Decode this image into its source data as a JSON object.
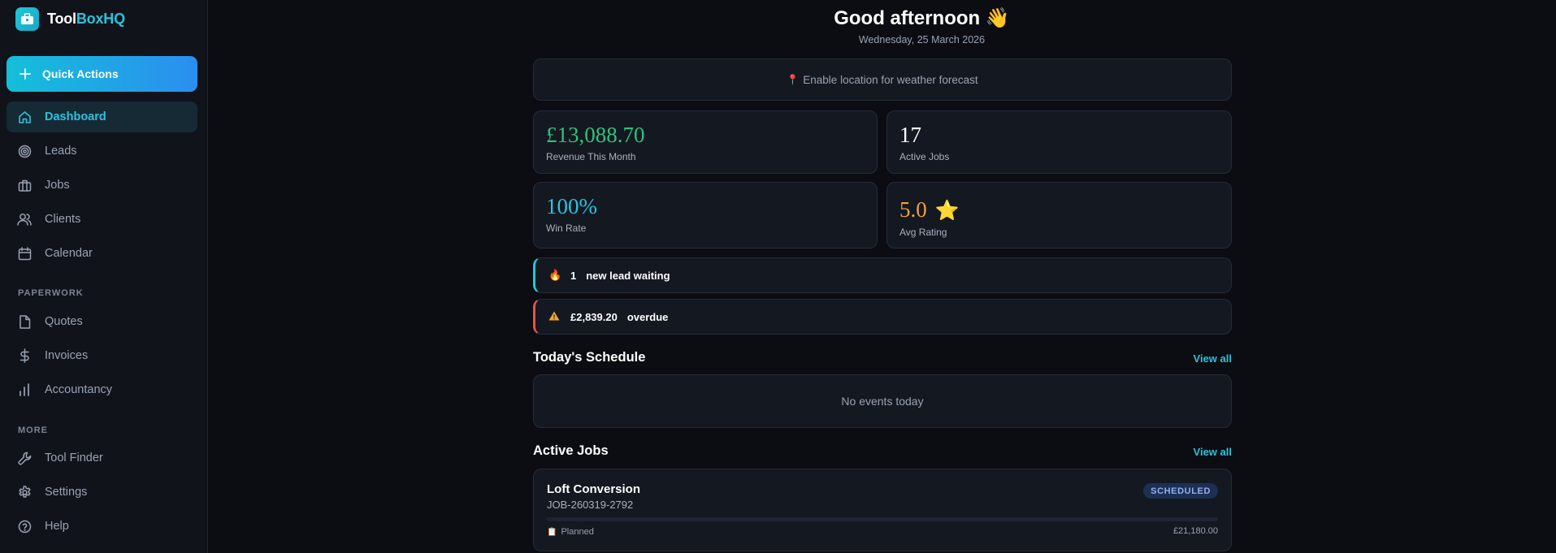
{
  "brand": {
    "part1": "Tool",
    "part2": "BoxHQ"
  },
  "sidebar": {
    "quick_actions": "Quick Actions",
    "items": [
      {
        "label": "Dashboard",
        "icon": "home-icon"
      },
      {
        "label": "Leads",
        "icon": "target-icon"
      },
      {
        "label": "Jobs",
        "icon": "briefcase-icon"
      },
      {
        "label": "Clients",
        "icon": "users-icon"
      },
      {
        "label": "Calendar",
        "icon": "calendar-icon"
      }
    ],
    "section_paperwork": "PAPERWORK",
    "paperwork": [
      {
        "label": "Quotes",
        "icon": "file-icon"
      },
      {
        "label": "Invoices",
        "icon": "dollar-icon"
      },
      {
        "label": "Accountancy",
        "icon": "bar-chart-icon"
      }
    ],
    "section_more": "MORE",
    "more": [
      {
        "label": "Tool Finder",
        "icon": "wrench-icon"
      },
      {
        "label": "Settings",
        "icon": "gear-icon"
      },
      {
        "label": "Help",
        "icon": "help-icon"
      }
    ]
  },
  "header": {
    "greeting": "Good afternoon",
    "greeting_emoji": "👋",
    "date": "Wednesday, 25 March 2026"
  },
  "weather": {
    "pin": "📍",
    "text": "Enable location for weather forecast"
  },
  "stats": {
    "revenue": {
      "value": "£13,088.70",
      "label": "Revenue This Month",
      "color": "#2ec27e"
    },
    "active_jobs": {
      "value": "17",
      "label": "Active Jobs",
      "color": "#ffffff"
    },
    "win_rate": {
      "value": "100%",
      "label": "Win Rate",
      "color": "#2bc3dd"
    },
    "avg_rating": {
      "value": "5.0",
      "emoji": "⭐",
      "label": "Avg Rating",
      "color": "#f0a23b"
    }
  },
  "alerts": {
    "leads": {
      "emoji": "🔥",
      "count": "1",
      "text": "new lead waiting"
    },
    "overdue": {
      "emoji": "⚠️",
      "amount": "£2,839.20",
      "text": "overdue"
    }
  },
  "schedule": {
    "title": "Today's Schedule",
    "view_all": "View all",
    "empty": "No events today"
  },
  "active_jobs": {
    "title": "Active Jobs",
    "view_all": "View all",
    "jobs": [
      {
        "title": "Loft Conversion",
        "code": "JOB-260319-2792",
        "status": "SCHEDULED",
        "stage_icon": "📋",
        "stage": "Planned",
        "amount": "£21,180.00",
        "progress": 0
      }
    ]
  }
}
